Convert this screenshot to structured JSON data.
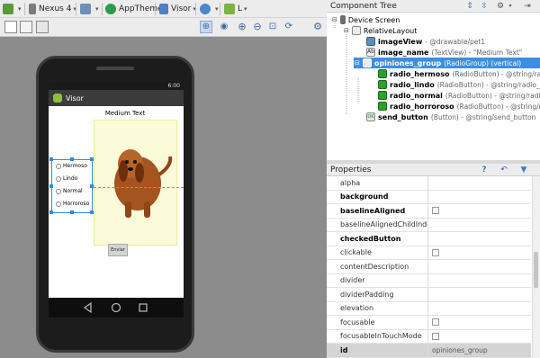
{
  "toolbar": {
    "device_label": "Nexus 4",
    "theme_label": "AppTheme",
    "activity_label": "Visor",
    "api_label": "L"
  },
  "preview": {
    "app_title": "Visor",
    "status_time": "6:00",
    "medium_text": "Medium Text",
    "radios": [
      "Hermoso",
      "Lindo",
      "Normal",
      "Horroroso"
    ],
    "send_button_label": "Enviar"
  },
  "component_tree": {
    "title": "Component Tree",
    "items": [
      {
        "name": "Device Screen",
        "details": "",
        "icon": "device-icon",
        "indent": 0
      },
      {
        "name": "RelativeLayout",
        "details": "",
        "icon": "layout-icon",
        "indent": 1
      },
      {
        "name": "imageView",
        "details": "- @drawable/pet1",
        "icon": "image-icon",
        "indent": 2
      },
      {
        "name": "image_name",
        "details": "(TextView) - \"Medium Text\"",
        "icon": "text-icon",
        "indent": 2
      },
      {
        "name": "opiniones_group",
        "details": "(RadioGroup) (vertical)",
        "icon": "radiogroup-icon",
        "indent": 2,
        "selected": true
      },
      {
        "name": "radio_hermoso",
        "details": "(RadioButton) - @string/radio_he",
        "icon": "radio-icon",
        "indent": 3
      },
      {
        "name": "radio_lindo",
        "details": "(RadioButton) - @string/radio_lin",
        "icon": "radio-icon",
        "indent": 3
      },
      {
        "name": "radio_normal",
        "details": "(RadioButton) - @string/radio_no",
        "icon": "radio-icon",
        "indent": 3
      },
      {
        "name": "radio_horroroso",
        "details": "(RadioButton) - @string/radio_h",
        "icon": "radio-icon",
        "indent": 3
      },
      {
        "name": "send_button",
        "details": "(Button) - @string/send_button",
        "icon": "button-icon",
        "indent": 2
      }
    ]
  },
  "properties": {
    "title": "Properties",
    "rows": [
      {
        "name": "alpha",
        "bold": false,
        "value": "",
        "checkbox": false
      },
      {
        "name": "background",
        "bold": true,
        "value": "",
        "checkbox": false
      },
      {
        "name": "baselineAligned",
        "bold": true,
        "value": "",
        "checkbox": true
      },
      {
        "name": "baselineAlignedChildIndex",
        "bold": false,
        "value": "",
        "checkbox": false
      },
      {
        "name": "checkedButton",
        "bold": true,
        "value": "",
        "checkbox": false
      },
      {
        "name": "clickable",
        "bold": false,
        "value": "",
        "checkbox": true
      },
      {
        "name": "contentDescription",
        "bold": false,
        "value": "",
        "checkbox": false
      },
      {
        "name": "divider",
        "bold": false,
        "value": "",
        "checkbox": false
      },
      {
        "name": "dividerPadding",
        "bold": false,
        "value": "",
        "checkbox": false
      },
      {
        "name": "elevation",
        "bold": false,
        "value": "",
        "checkbox": false
      },
      {
        "name": "focusable",
        "bold": false,
        "value": "",
        "checkbox": true
      },
      {
        "name": "focusableInTouchMode",
        "bold": false,
        "value": "",
        "checkbox": true
      },
      {
        "name": "id",
        "bold": true,
        "value": "opiniones_group",
        "checkbox": false,
        "highlight": true
      }
    ]
  },
  "colors": {
    "selection": "#3d8ee0",
    "canvas": "#8c8c8c",
    "accent_icon": "#3d7ebf"
  }
}
